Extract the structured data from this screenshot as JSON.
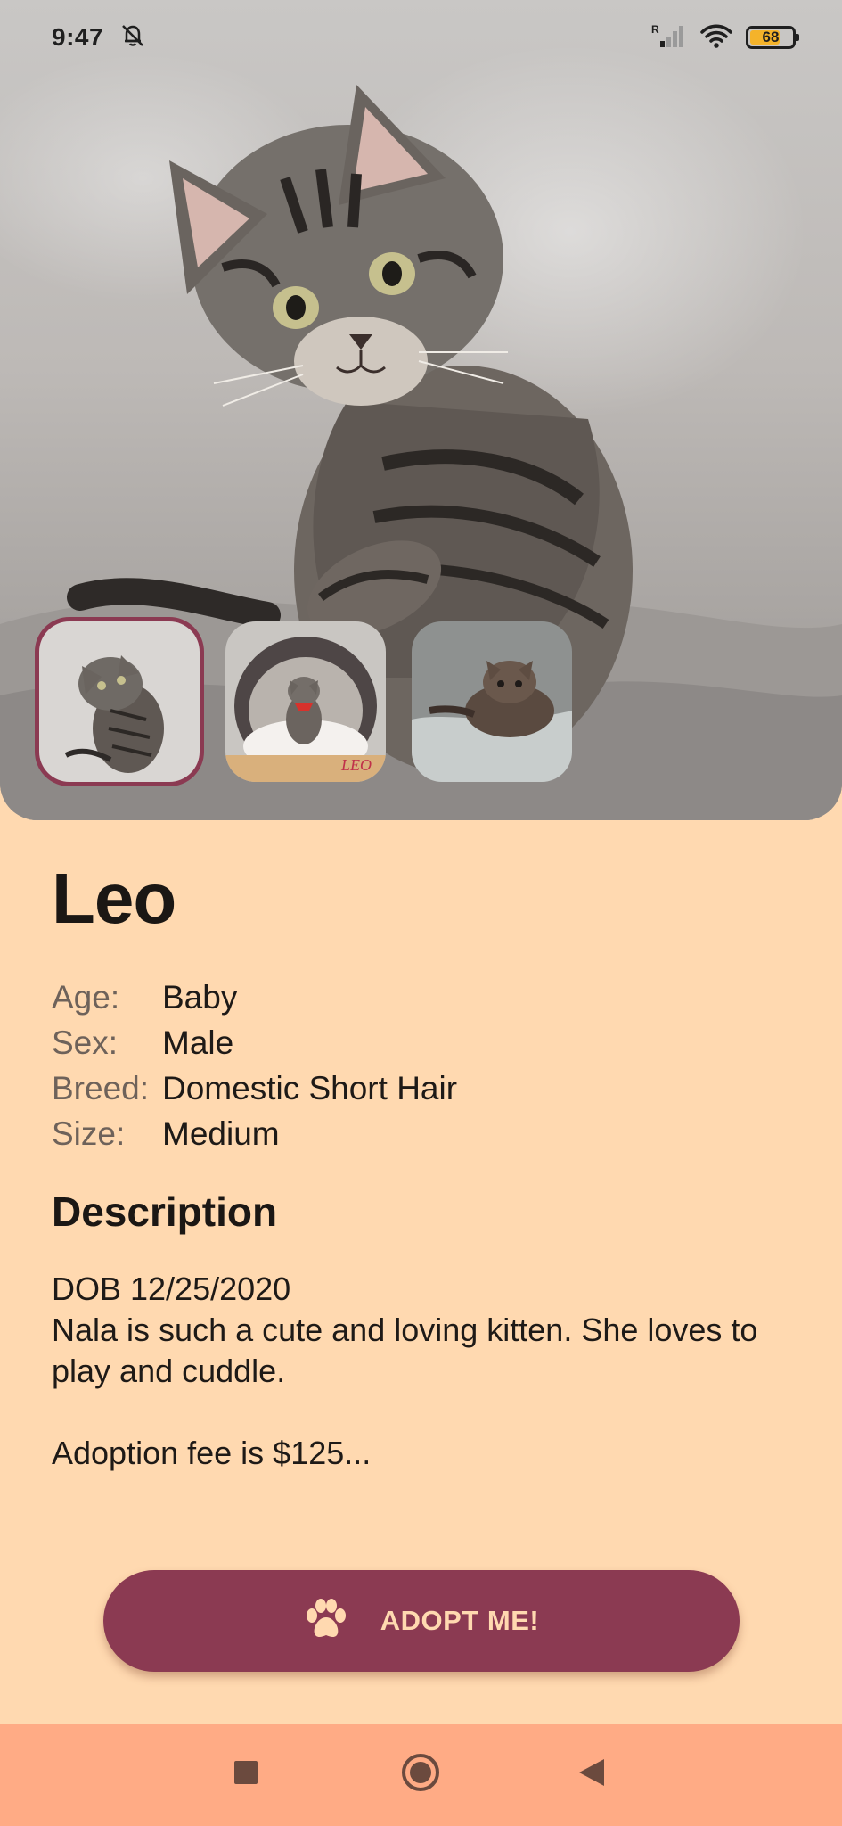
{
  "status_bar": {
    "time": "9:47",
    "battery_level": "68",
    "network_label": "R"
  },
  "hero": {
    "thumbnails": [
      {
        "name": "leo-photo-1",
        "selected": true
      },
      {
        "name": "leo-photo-2",
        "selected": false,
        "overlay_text": "LEO"
      },
      {
        "name": "leo-photo-3",
        "selected": false
      }
    ]
  },
  "pet": {
    "name": "Leo",
    "attributes": [
      {
        "label": "Age:",
        "value": "Baby"
      },
      {
        "label": "Sex:",
        "value": "Male"
      },
      {
        "label": "Breed:",
        "value": "Domestic Short Hair"
      },
      {
        "label": "Size:",
        "value": "Medium"
      }
    ],
    "description_heading": "Description",
    "description_lines": [
      "DOB 12/25/2020",
      "Nala is such a cute and loving kitten. She loves to play and cuddle.",
      "",
      "Adoption fee is $125..."
    ]
  },
  "adopt_button": {
    "label": "ADOPT ME!",
    "icon": "paw-icon"
  },
  "nav_bar": {
    "recents_icon": "square-recents-icon",
    "home_icon": "circle-home-icon",
    "back_icon": "triangle-back-icon"
  },
  "colors": {
    "background": "#FFD9B0",
    "accent": "#8B3A52",
    "nav_bar": "#FFAB85",
    "battery": "#F4B32A"
  }
}
